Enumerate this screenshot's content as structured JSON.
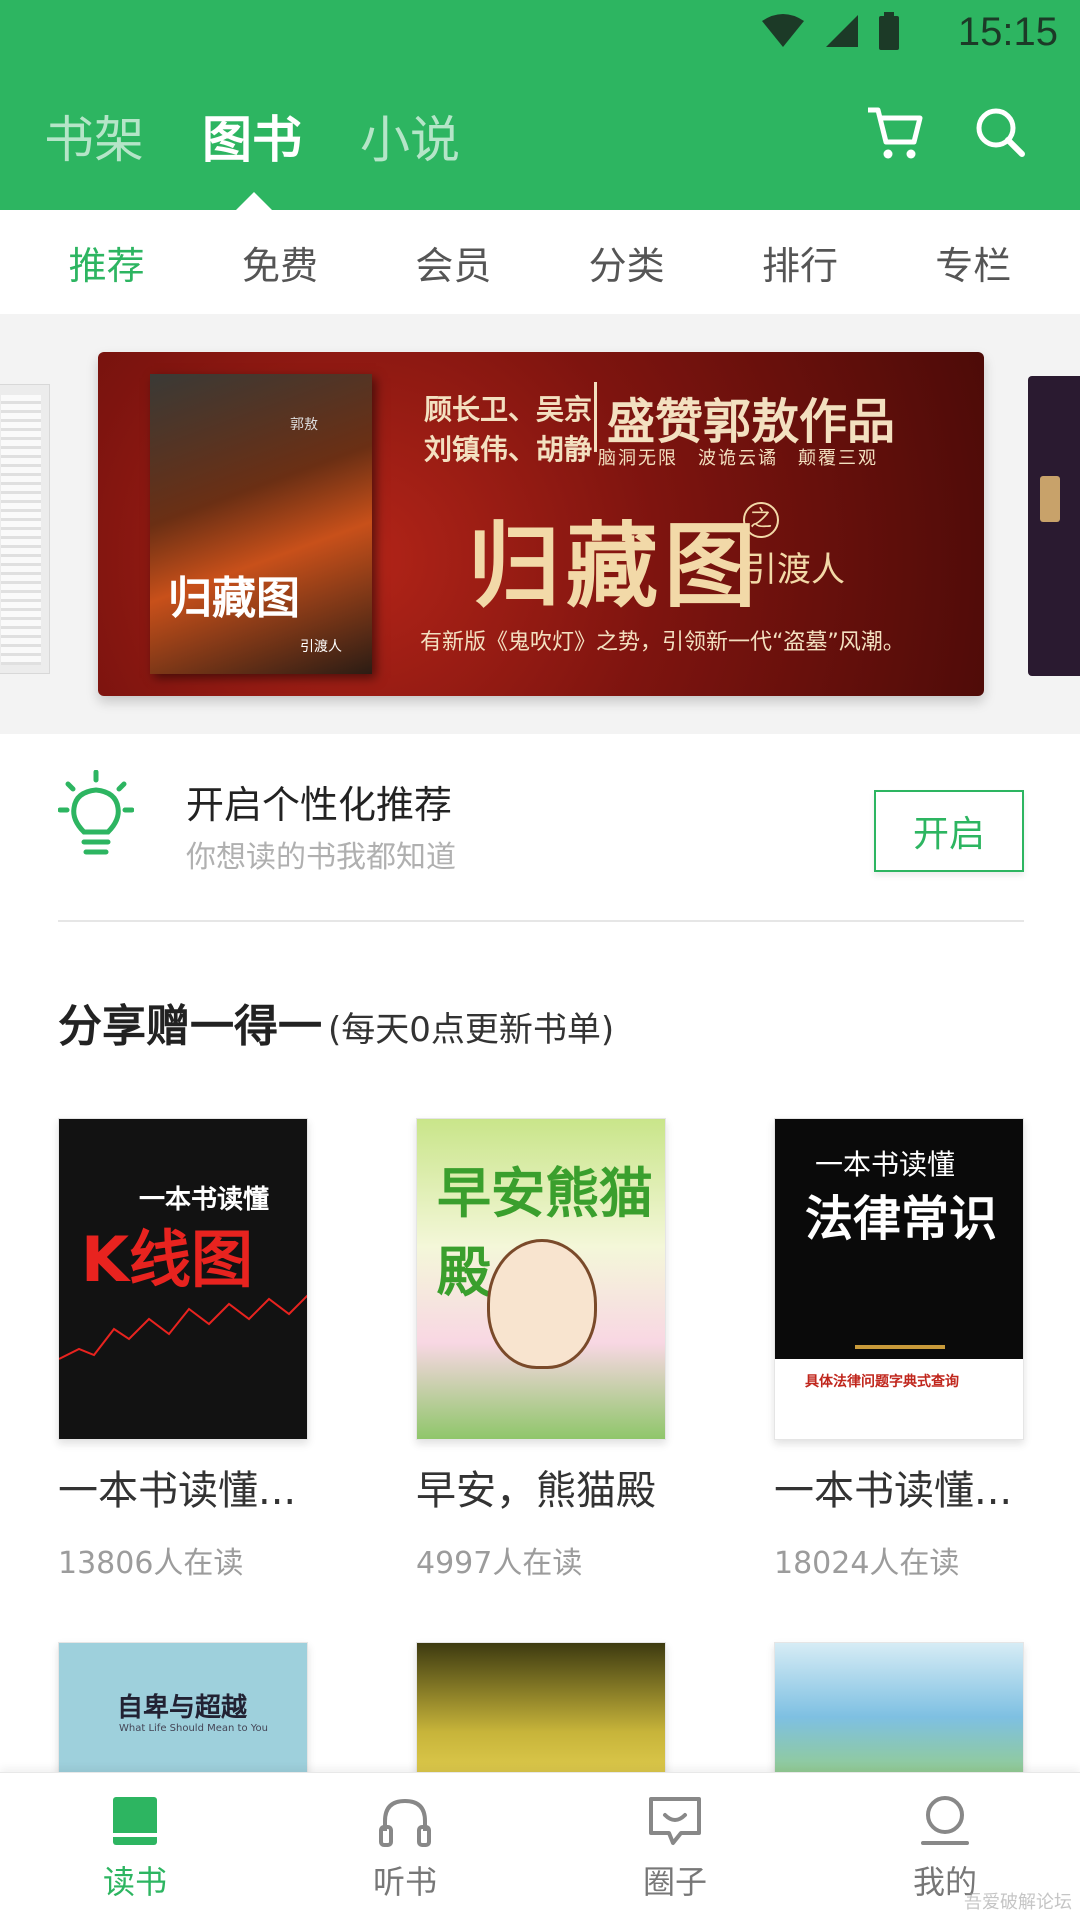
{
  "status_bar": {
    "time": "15:15"
  },
  "header": {
    "tabs": [
      {
        "label": "书架",
        "active": false
      },
      {
        "label": "图书",
        "active": true
      },
      {
        "label": "小说",
        "active": false
      }
    ],
    "icons": [
      "cart-icon",
      "search-icon"
    ]
  },
  "sub_tabs": [
    {
      "label": "推荐",
      "active": true
    },
    {
      "label": "免费",
      "active": false
    },
    {
      "label": "会员",
      "active": false
    },
    {
      "label": "分类",
      "active": false
    },
    {
      "label": "排行",
      "active": false
    },
    {
      "label": "专栏",
      "active": false
    }
  ],
  "banner": {
    "book_title": "归藏图",
    "book_subtitle": "引渡人",
    "book_author": "郭敖",
    "authors_line1": "顾长卫、吴京",
    "authors_line2": "刘镇伟、胡静",
    "praise": "盛赞郭敖作品",
    "keywords": "脑洞无限　波诡云谲　颠覆三观",
    "big_title": "归藏图",
    "zhi": "之",
    "sub_title": "引渡人",
    "tagline": "有新版《鬼吹灯》之势，引领新一代“盗墓”风潮。"
  },
  "personalization": {
    "title": "开启个性化推荐",
    "subtitle": "你想读的书我都知道",
    "button": "开启",
    "icon": "lightbulb-icon"
  },
  "section": {
    "title": "分享赠一得一",
    "note": "(每天0点更新书单)"
  },
  "books": [
    {
      "title": "一本书读懂...",
      "readers": "13806人在读",
      "cover_line1": "一本书读懂",
      "cover_line2": "K线图"
    },
    {
      "title": "早安，熊猫殿",
      "readers": "4997人在读",
      "cover_line1": "早安熊猫殿"
    },
    {
      "title": "一本书读懂...",
      "readers": "18024人在读",
      "cover_line1": "一本书读懂",
      "cover_line2": "法律常识",
      "cover_line3": "具体法律问题字典式查询"
    }
  ],
  "books_row2": [
    {
      "cover_line1": "自卑与超越",
      "cover_line2": "What Life Should Mean to You"
    },
    {
      "cover_line1": ""
    },
    {
      "cover_line1": ""
    }
  ],
  "bottom_nav": [
    {
      "label": "读书",
      "icon": "book-icon",
      "active": true
    },
    {
      "label": "听书",
      "icon": "headphones-icon",
      "active": false
    },
    {
      "label": "圈子",
      "icon": "chat-icon",
      "active": false
    },
    {
      "label": "我的",
      "icon": "profile-icon",
      "active": false
    }
  ],
  "watermark": "吾爱破解论坛",
  "colors": {
    "accent": "#2db561"
  }
}
